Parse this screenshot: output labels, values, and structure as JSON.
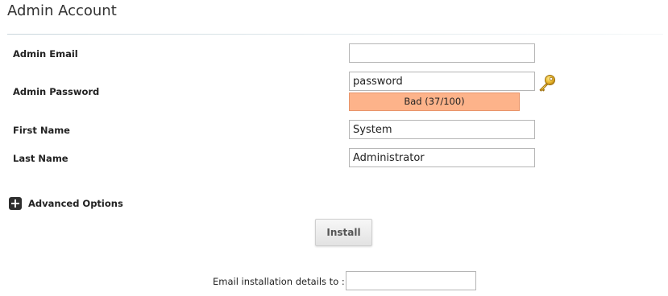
{
  "section": {
    "title": "Admin Account"
  },
  "fields": {
    "admin_email": {
      "label": "Admin Email",
      "value": ""
    },
    "admin_password": {
      "label": "Admin Password",
      "value": "password"
    },
    "first_name": {
      "label": "First Name",
      "value": "System"
    },
    "last_name": {
      "label": "Last Name",
      "value": "Administrator"
    }
  },
  "password_strength": {
    "label": "Bad (37/100)",
    "score": 37,
    "max": 100,
    "color": "#fdb38a"
  },
  "icons": {
    "password_generator": "key-icon",
    "advanced_toggle": "plus-icon"
  },
  "advanced_options": {
    "label": "Advanced Options"
  },
  "install_button": {
    "label": "Install"
  },
  "email_details": {
    "label": "Email installation details to :",
    "value": ""
  }
}
